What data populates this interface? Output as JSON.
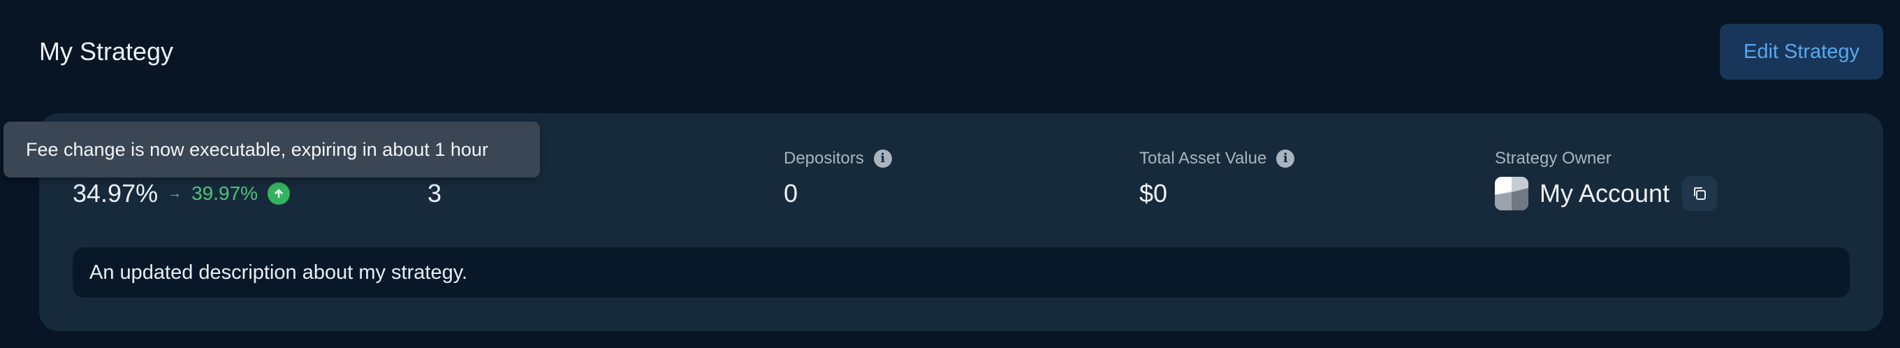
{
  "header": {
    "title": "My Strategy",
    "edit_button_label": "Edit Strategy"
  },
  "stats": {
    "fee": {
      "current": "34.97%",
      "new": "39.97%"
    },
    "second": {
      "value": "3"
    },
    "depositors": {
      "label": "Depositors",
      "value": "0"
    },
    "total_asset_value": {
      "label": "Total Asset Value",
      "value": "$0"
    },
    "owner": {
      "label": "Strategy Owner",
      "name": "My Account"
    }
  },
  "description": "An updated description about my strategy.",
  "tooltip": "Fee change is now executable, expiring in about 1 hour",
  "colors": {
    "background": "#071525",
    "card": "#172a3b",
    "accent_button": "#183659",
    "accent_text": "#5aa7ee",
    "positive": "#4fc27a"
  },
  "icons": {
    "info": "info-icon",
    "arrow": "arrow-right-icon",
    "increase": "arrow-up-circle-icon",
    "copy": "copy-icon"
  }
}
